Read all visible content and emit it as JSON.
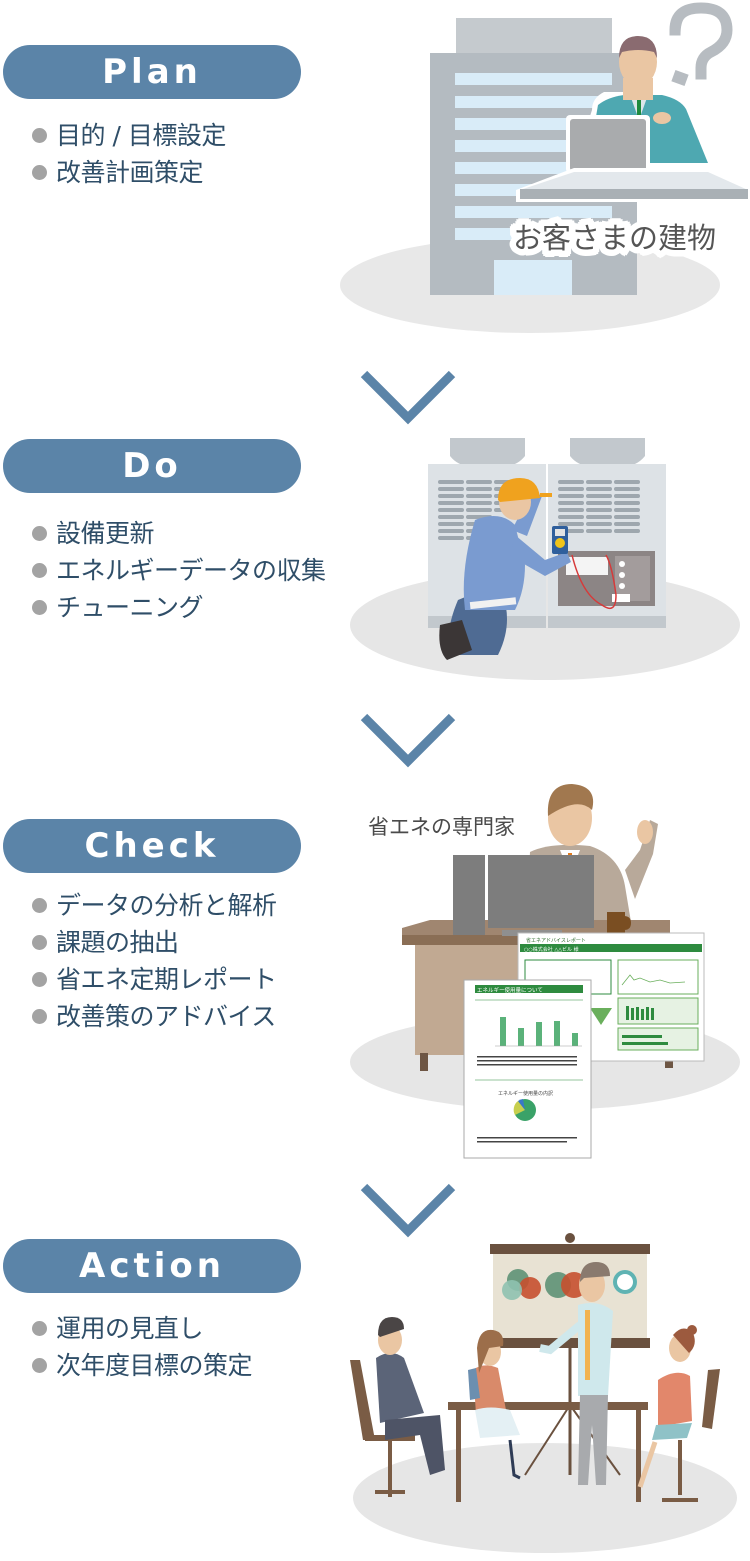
{
  "colors": {
    "pill": "#5b84a8",
    "pill_text": "#ffffff",
    "item_text": "#2f4e68",
    "bullet": "#a3a3a3",
    "arrow": "#5b84a8",
    "caption": "#4a4a4a"
  },
  "stages": [
    {
      "id": "plan",
      "label": "Plan",
      "items": [
        "目的 / 目標設定",
        "改善計画策定"
      ],
      "illustration": {
        "description": "customer building with man at laptop and question mark",
        "caption": "お客さまの建物"
      }
    },
    {
      "id": "do",
      "label": "Do",
      "items": [
        "設備更新",
        "エネルギーデータの収集",
        "チューニング"
      ],
      "illustration": {
        "description": "worker with hard hat measuring electrical panel of outdoor AC units"
      }
    },
    {
      "id": "check",
      "label": "Check",
      "items": [
        "データの分析と解析",
        "課題の抽出",
        "省エネ定期レポート",
        "改善策のアドバイス"
      ],
      "illustration": {
        "description": "energy-saving expert at desk with printed reports",
        "caption": "省エネの専門家",
        "report_front": {
          "heading": "エネルギー使用量について",
          "pie_title": "エネルギー使用量の内訳"
        },
        "report_back": {
          "heading": "省エネアドバイスレポート",
          "company": "○○株式会社 △△ビル 様"
        }
      }
    },
    {
      "id": "action",
      "label": "Action",
      "items": [
        "運用の見直し",
        "次年度目標の策定"
      ],
      "illustration": {
        "description": "meeting with presenter in front of chart board"
      }
    }
  ],
  "arrows": [
    "chevron-down",
    "chevron-down",
    "chevron-down"
  ]
}
